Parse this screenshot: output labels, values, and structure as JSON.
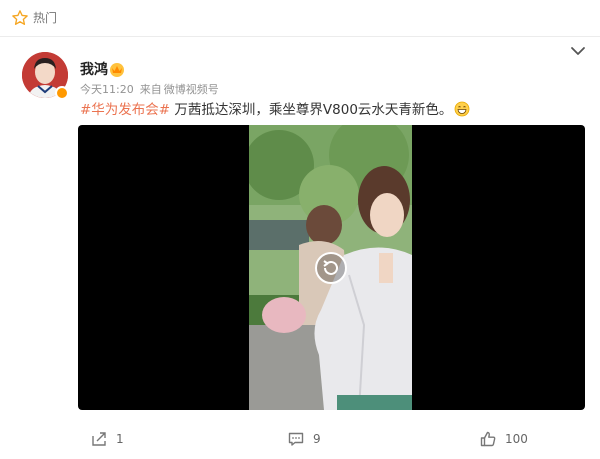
{
  "topbar": {
    "label": "热门",
    "icon": "star-icon"
  },
  "post": {
    "author": "我鸿",
    "time": "今天11:20",
    "source_prefix": "来自",
    "source": "微博视频号",
    "hashtag": "#华为发布会#",
    "text": " 万茜抵达深圳，乘坐尊界V800云水天青新色。",
    "emoji": "grin-emoji"
  },
  "actions": {
    "forward_count": "1",
    "comment_count": "9",
    "like_count": "100"
  },
  "colors": {
    "hashtag": "#eb7350",
    "video_bg": "#000000",
    "accent_orange": "#ff9900"
  }
}
